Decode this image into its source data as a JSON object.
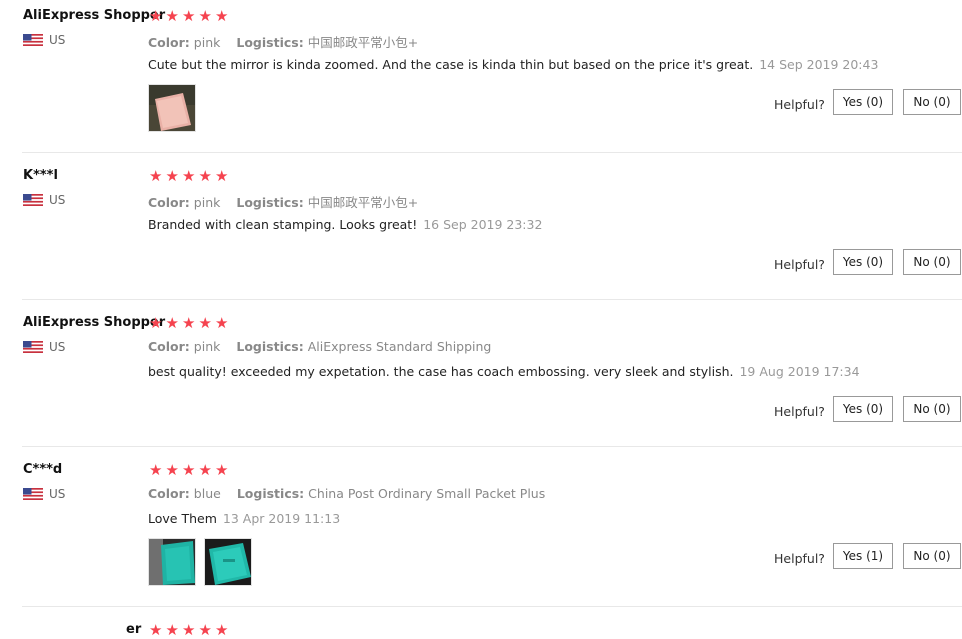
{
  "colors": {
    "star": "#f5434f",
    "divider": "#e8e8e8"
  },
  "helpful_label": "Helpful?",
  "color_key": "Color:",
  "logistics_key": "Logistics:",
  "star_glyph": "★",
  "reviews": [
    {
      "user": "AliExpress Shopper",
      "country": "US",
      "color": "pink",
      "logistics": "中国邮政平常小包+",
      "text": "Cute but the mirror is kinda zoomed. And the case is kinda thin but based on the price it's great.",
      "date": "14 Sep 2019 20:43",
      "rating": 5,
      "yes": "Yes (0)",
      "no": "No (0)",
      "photos": [
        "pink-case-photo"
      ]
    },
    {
      "user": "K***l",
      "country": "US",
      "color": "pink",
      "logistics": "中国邮政平常小包+",
      "text": "Branded with clean stamping. Looks great!",
      "date": "16 Sep 2019 23:32",
      "rating": 5,
      "yes": "Yes (0)",
      "no": "No (0)",
      "photos": []
    },
    {
      "user": "AliExpress Shopper",
      "country": "US",
      "color": "pink",
      "logistics": "AliExpress Standard Shipping",
      "text": "best quality! exceeded my expetation. the case has coach embossing. very sleek and stylish.",
      "date": "19 Aug 2019 17:34",
      "rating": 5,
      "yes": "Yes (0)",
      "no": "No (0)",
      "photos": []
    },
    {
      "user": "C***d",
      "country": "US",
      "color": "blue",
      "logistics": "China Post Ordinary Small Packet Plus",
      "text": "Love Them",
      "date": "13 Apr 2019 11:13",
      "rating": 5,
      "yes": "Yes (1)",
      "no": "No (0)",
      "photos": [
        "teal-case-photo-1",
        "teal-case-photo-2"
      ]
    },
    {
      "user_partial": "er",
      "rating": 5
    }
  ]
}
